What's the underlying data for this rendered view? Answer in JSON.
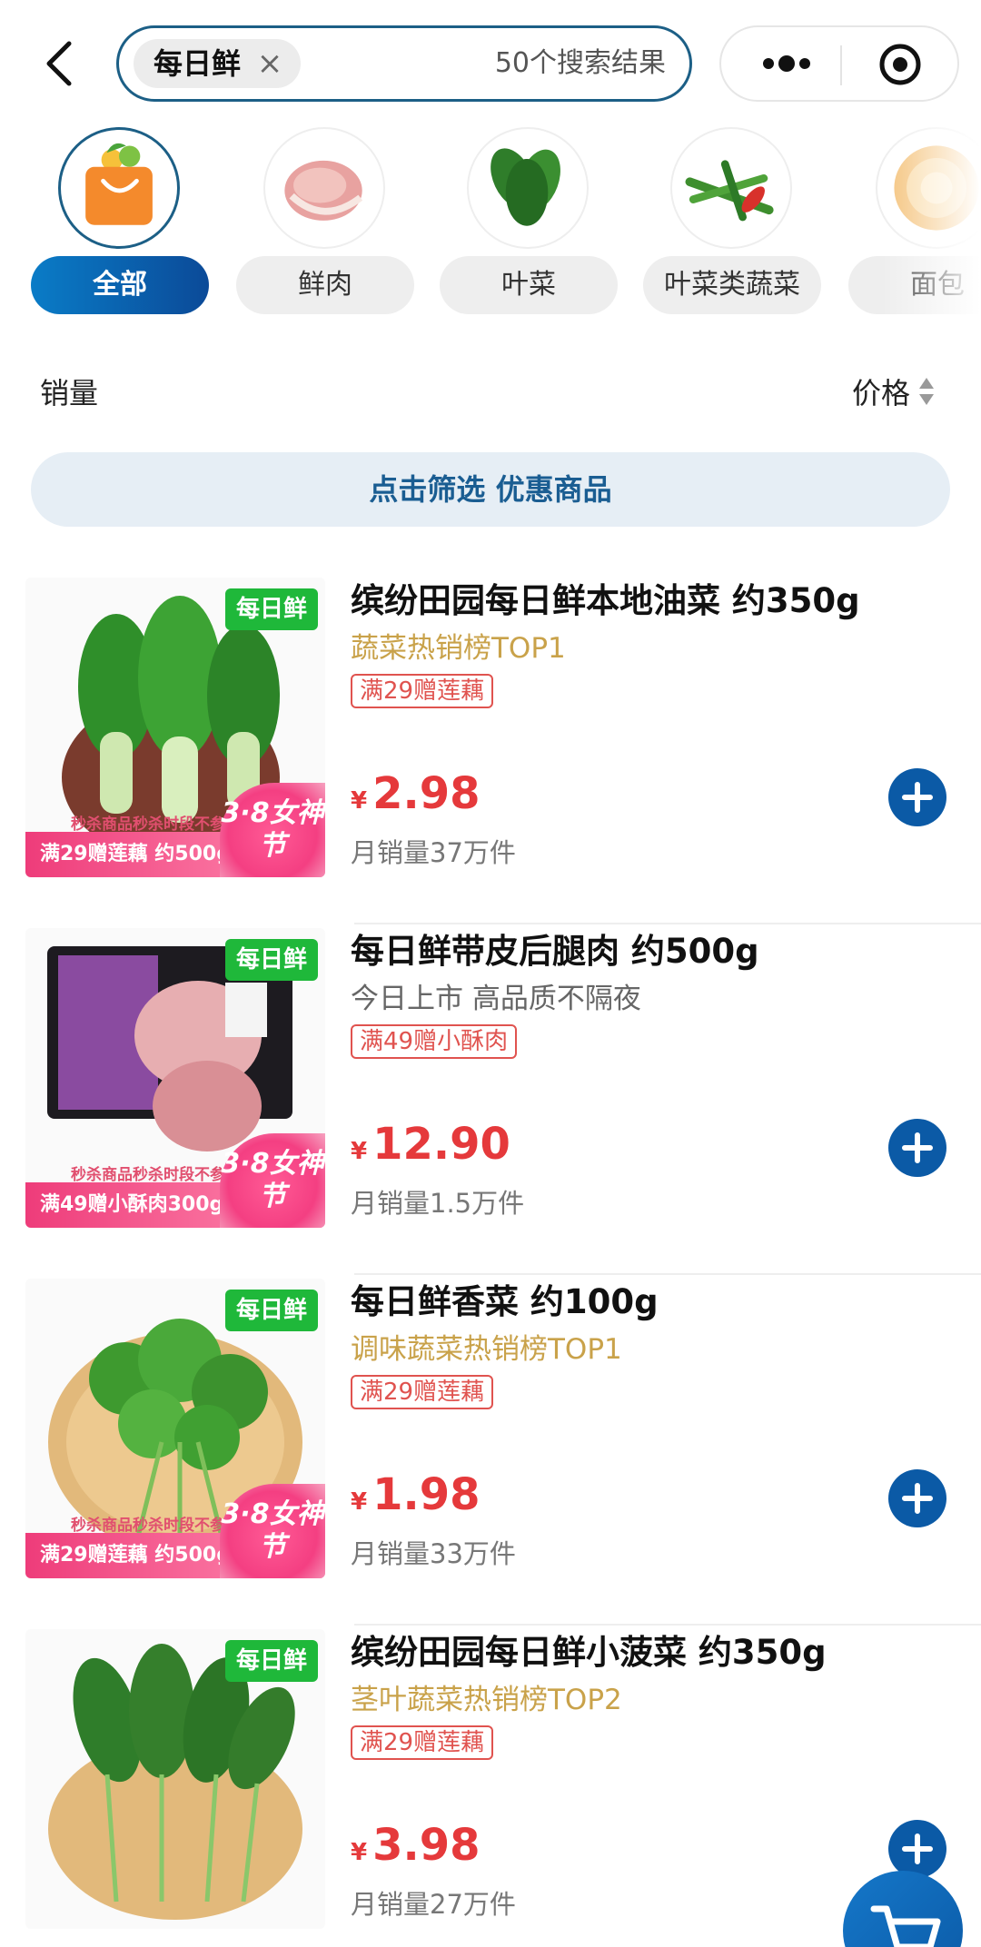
{
  "header": {
    "search_chip": "每日鲜",
    "chip_close": "×",
    "result_count": "50个搜索结果"
  },
  "categories": [
    {
      "label": "全部",
      "active": true
    },
    {
      "label": "鲜肉",
      "active": false
    },
    {
      "label": "叶菜",
      "active": false
    },
    {
      "label": "叶菜类蔬菜",
      "active": false
    },
    {
      "label": "面包",
      "active": false
    }
  ],
  "sort": {
    "sales_label": "销量",
    "price_label": "价格"
  },
  "filter_banner": "点击筛选 优惠商品",
  "products": [
    {
      "title": "缤纷田园每日鲜本地油菜 约350g",
      "subtitle": "蔬菜热销榜TOP1",
      "promo": "满29赠莲藕",
      "currency": "¥",
      "price": "2.98",
      "sales": "月销量37万件",
      "img_badge": "每日鲜",
      "img_note": "秒杀商品秒杀时段不参与",
      "img_strip": "满29赠莲藕 约500g",
      "img_festival": "3·8女神节"
    },
    {
      "title": "每日鲜带皮后腿肉 约500g",
      "subtitle": "今日上市 高品质不隔夜",
      "promo": "满49赠小酥肉",
      "currency": "¥",
      "price": "12.90",
      "sales": "月销量1.5万件",
      "img_badge": "每日鲜",
      "img_note": "秒杀商品秒杀时段不参与",
      "img_strip": "满49赠小酥肉300g",
      "img_festival": "3·8女神节"
    },
    {
      "title": "每日鲜香菜 约100g",
      "subtitle": "调味蔬菜热销榜TOP1",
      "promo": "满29赠莲藕",
      "currency": "¥",
      "price": "1.98",
      "sales": "月销量33万件",
      "img_badge": "每日鲜",
      "img_note": "秒杀商品秒杀时段不参与",
      "img_strip": "满29赠莲藕 约500g",
      "img_festival": "3·8女神节"
    },
    {
      "title": "缤纷田园每日鲜小菠菜 约350g",
      "subtitle": "茎叶蔬菜热销榜TOP2",
      "promo": "满29赠莲藕",
      "currency": "¥",
      "price": "3.98",
      "sales": "月销量27万件",
      "img_badge": "每日鲜"
    }
  ],
  "colors": {
    "accent": "#0b5aa6",
    "price": "#e5393b",
    "gold": "#c9a24a",
    "promo_border": "#e0534f",
    "badge_green": "#1fb83a"
  },
  "icons": [
    "back-icon",
    "close-icon",
    "more-icon",
    "target-icon",
    "sort-arrows-icon",
    "add-to-cart-icon",
    "cart-icon"
  ]
}
